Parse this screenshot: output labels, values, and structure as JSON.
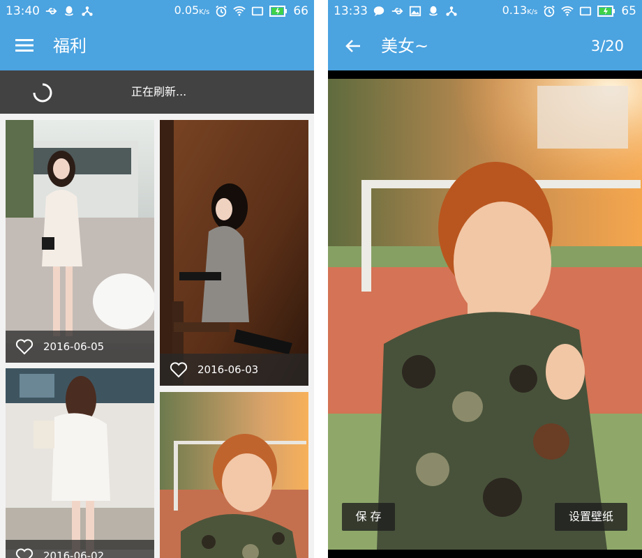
{
  "left": {
    "status": {
      "time": "13:40",
      "speed": "0.05",
      "speed_unit": "K/s",
      "battery": "66"
    },
    "appbar": {
      "title": "福利"
    },
    "refresh": {
      "text": "正在刷新..."
    },
    "cards": [
      {
        "date": "2016-06-05"
      },
      {
        "date": "2016-06-03"
      },
      {
        "date": "2016-06-02"
      }
    ]
  },
  "right": {
    "status": {
      "time": "13:33",
      "speed": "0.13",
      "speed_unit": "K/s",
      "battery": "65"
    },
    "appbar": {
      "title": "美女~",
      "counter": "3/20"
    },
    "buttons": {
      "save": "保 存",
      "wallpaper": "设置壁纸"
    }
  },
  "colors": {
    "primary": "#4ba3e0",
    "refresh_bar": "#424242",
    "caption_bg": "rgba(40,40,40,0.75)"
  }
}
